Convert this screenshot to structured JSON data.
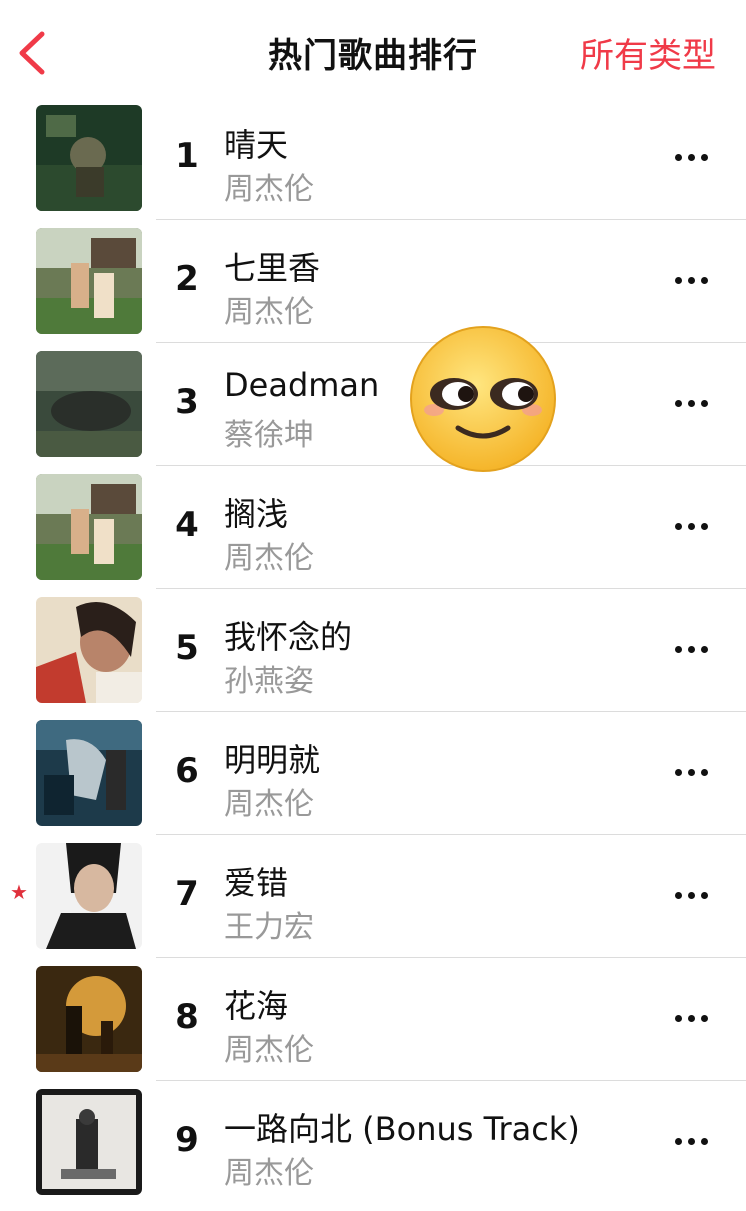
{
  "header": {
    "title": "热门歌曲排行",
    "filter_label": "所有类型"
  },
  "songs": [
    {
      "rank": "1",
      "title": "晴天",
      "artist": "周杰伦"
    },
    {
      "rank": "2",
      "title": "七里香",
      "artist": "周杰伦"
    },
    {
      "rank": "3",
      "title": "Deadman",
      "artist": "蔡徐坤"
    },
    {
      "rank": "4",
      "title": "搁浅",
      "artist": "周杰伦"
    },
    {
      "rank": "5",
      "title": "我怀念的",
      "artist": "孙燕姿"
    },
    {
      "rank": "6",
      "title": "明明就",
      "artist": "周杰伦"
    },
    {
      "rank": "7",
      "title": "爱错",
      "artist": "王力宏"
    },
    {
      "rank": "8",
      "title": "花海",
      "artist": "周杰伦"
    },
    {
      "rank": "9",
      "title": "一路向北 (Bonus Track)",
      "artist": "周杰伦"
    }
  ],
  "colors": {
    "accent": "#f03a48",
    "secondary_text": "#999999"
  }
}
